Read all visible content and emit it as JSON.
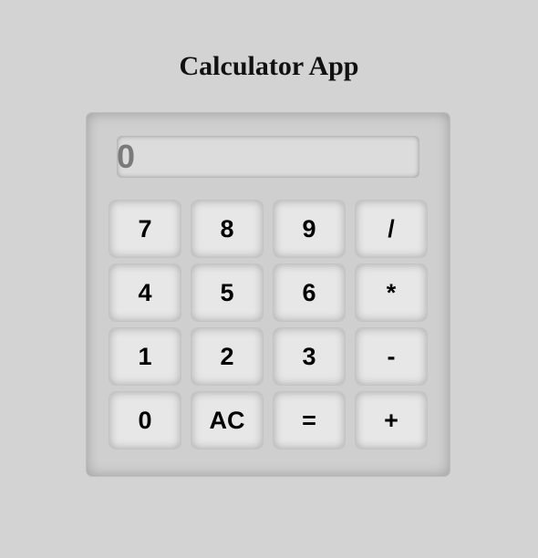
{
  "app": {
    "title": "Calculator App"
  },
  "display": {
    "value": "0"
  },
  "keys": [
    {
      "label": "7",
      "name": "key-7"
    },
    {
      "label": "8",
      "name": "key-8"
    },
    {
      "label": "9",
      "name": "key-9"
    },
    {
      "label": "/",
      "name": "key-divide"
    },
    {
      "label": "4",
      "name": "key-4"
    },
    {
      "label": "5",
      "name": "key-5"
    },
    {
      "label": "6",
      "name": "key-6"
    },
    {
      "label": "*",
      "name": "key-multiply"
    },
    {
      "label": "1",
      "name": "key-1"
    },
    {
      "label": "2",
      "name": "key-2"
    },
    {
      "label": "3",
      "name": "key-3"
    },
    {
      "label": "-",
      "name": "key-subtract"
    },
    {
      "label": "0",
      "name": "key-0"
    },
    {
      "label": "AC",
      "name": "key-all-clear"
    },
    {
      "label": "=",
      "name": "key-equals"
    },
    {
      "label": "+",
      "name": "key-add"
    }
  ],
  "colors": {
    "page_background": "#d3d3d3",
    "display_text": "#7a7a7a",
    "key_background": "#e7e7e7"
  }
}
